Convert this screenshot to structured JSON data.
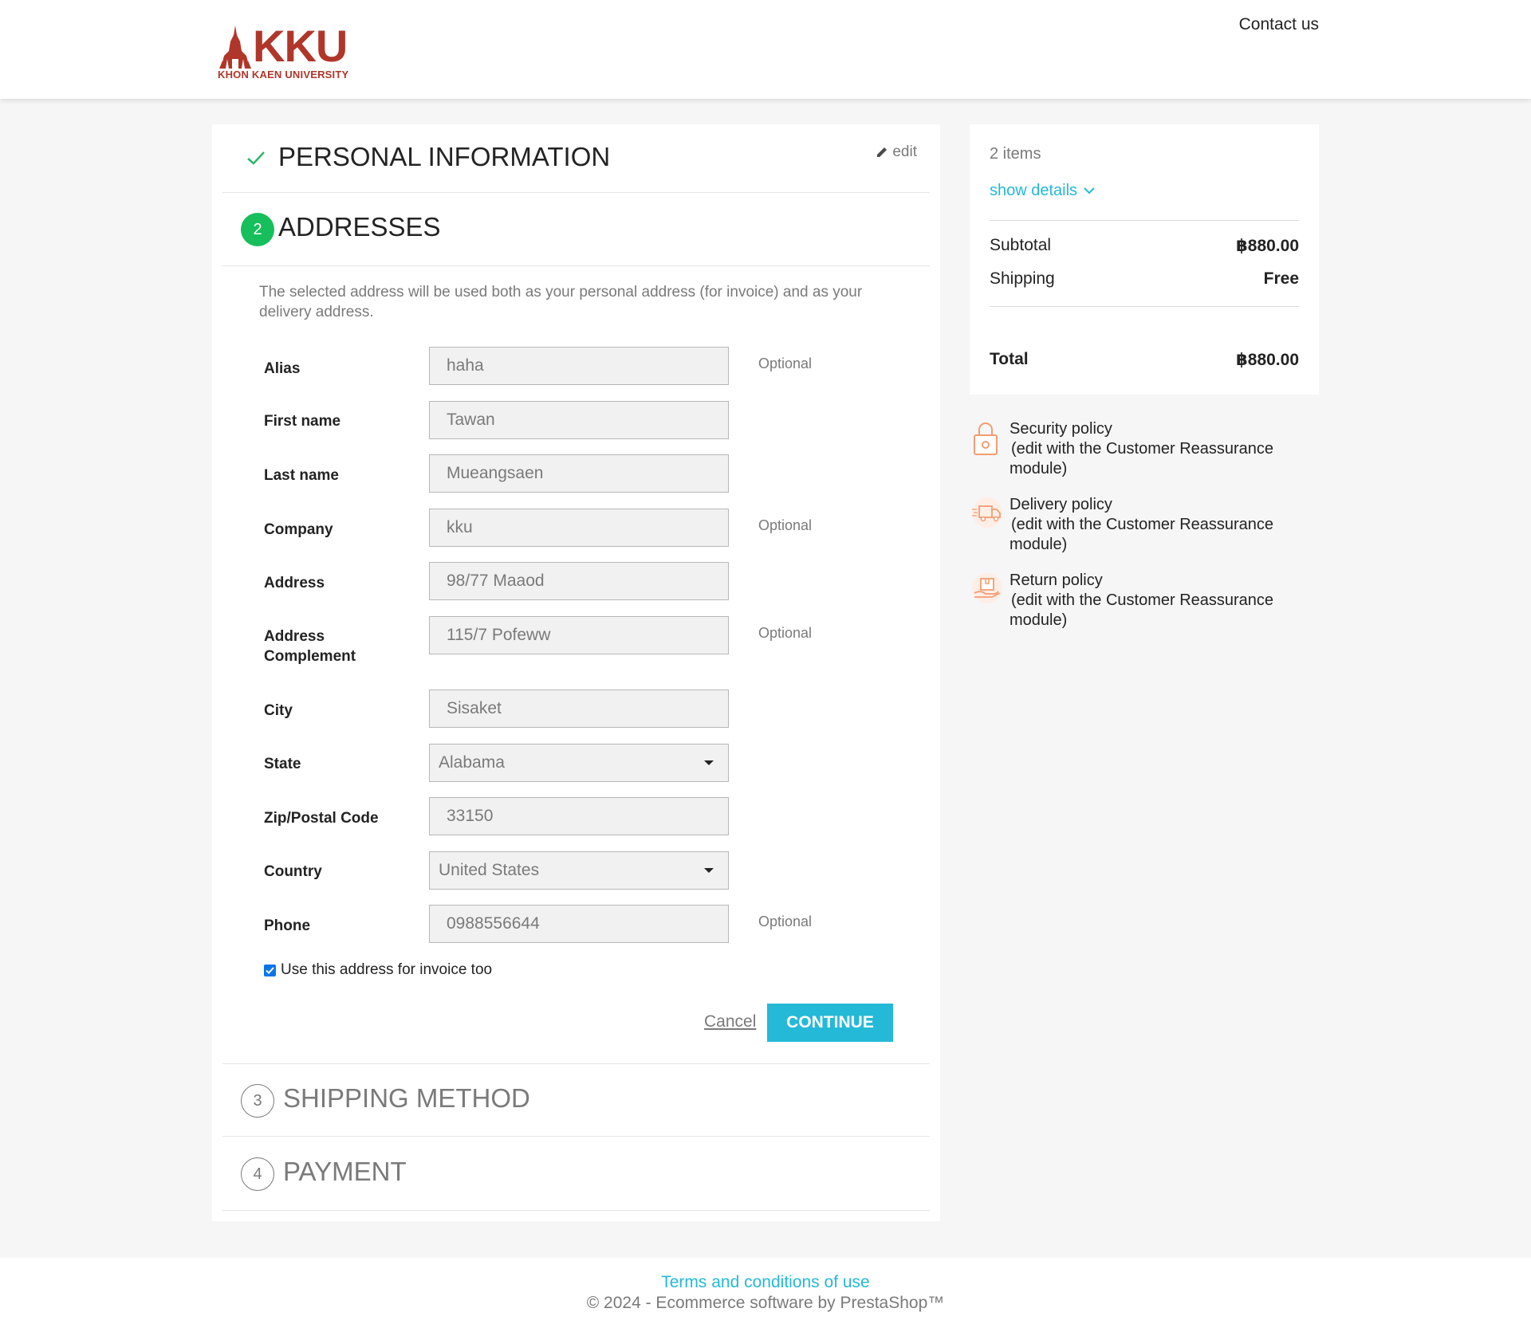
{
  "header": {
    "logo_text": "KKU",
    "logo_subtext": "KHON KAEN UNIVERSITY",
    "contact_label": "Contact us"
  },
  "steps": {
    "personal": {
      "title": "Personal Information",
      "edit_label": "edit"
    },
    "addresses": {
      "number": "2",
      "title": "Addresses"
    },
    "shipping": {
      "number": "3",
      "title": "Shipping Method"
    },
    "payment": {
      "number": "4",
      "title": "Payment"
    }
  },
  "form": {
    "intro": "The selected address will be used both as your personal address (for invoice) and as your delivery address.",
    "optional_label": "Optional",
    "fields": {
      "alias": {
        "label": "Alias",
        "value": "haha"
      },
      "first_name": {
        "label": "First name",
        "value": "Tawan"
      },
      "last_name": {
        "label": "Last name",
        "value": "Mueangsaen"
      },
      "company": {
        "label": "Company",
        "value": "kku"
      },
      "address": {
        "label": "Address",
        "value": "98/77 Maaod"
      },
      "address_complement": {
        "label": "Address Complement",
        "value": "115/7 Pofeww"
      },
      "city": {
        "label": "City",
        "value": "Sisaket"
      },
      "state": {
        "label": "State",
        "value": "Alabama"
      },
      "zip": {
        "label": "Zip/Postal Code",
        "value": "33150"
      },
      "country": {
        "label": "Country",
        "value": "United States"
      },
      "phone": {
        "label": "Phone",
        "value": "0988556644"
      }
    },
    "invoice_checkbox_label": "Use this address for invoice too",
    "invoice_checked": true,
    "cancel_label": "Cancel",
    "continue_label": "Continue"
  },
  "cart_summary": {
    "items_count": "2 items",
    "show_details_label": "show details",
    "subtotal_label": "Subtotal",
    "subtotal_value": "฿880.00",
    "shipping_label": "Shipping",
    "shipping_value": "Free",
    "total_label": "Total",
    "total_value": "฿880.00"
  },
  "reassurance": [
    {
      "title": "Security policy",
      "desc": "(edit with the Customer Reassurance module)",
      "icon": "lock-icon"
    },
    {
      "title": "Delivery policy",
      "desc": "(edit with the Customer Reassurance module)",
      "icon": "truck-icon"
    },
    {
      "title": "Return policy",
      "desc": "(edit with the Customer Reassurance module)",
      "icon": "return-box-icon"
    }
  ],
  "footer": {
    "terms_label": "Terms and conditions of use",
    "copyright": "© 2024 - Ecommerce software by PrestaShop™"
  },
  "colors": {
    "accent": "#24b9d7",
    "success": "#17be5c",
    "brand": "#b0362a",
    "icon_orange": "#f39d72"
  }
}
